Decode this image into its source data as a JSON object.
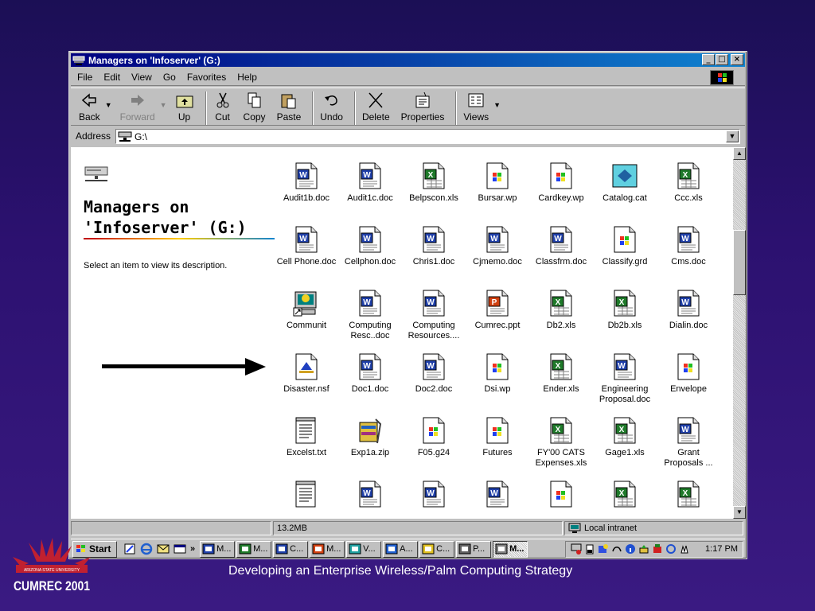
{
  "window": {
    "title": "Managers on 'Infoserver' (G:)",
    "buttons": {
      "minimize": "_",
      "maximize": "□",
      "close": "×"
    }
  },
  "menu": [
    "File",
    "Edit",
    "View",
    "Go",
    "Favorites",
    "Help"
  ],
  "toolbar": [
    {
      "label": "Back",
      "icon": "back-arrow-icon",
      "enabled": true
    },
    {
      "label": "Forward",
      "icon": "forward-arrow-icon",
      "enabled": false
    },
    {
      "label": "Up",
      "icon": "folder-up-icon",
      "enabled": true
    },
    {
      "label": "Cut",
      "icon": "scissors-icon",
      "enabled": true
    },
    {
      "label": "Copy",
      "icon": "copy-icon",
      "enabled": true
    },
    {
      "label": "Paste",
      "icon": "paste-icon",
      "enabled": true
    },
    {
      "label": "Undo",
      "icon": "undo-icon",
      "enabled": true
    },
    {
      "label": "Delete",
      "icon": "delete-x-icon",
      "enabled": true
    },
    {
      "label": "Properties",
      "icon": "properties-icon",
      "enabled": true
    },
    {
      "label": "Views",
      "icon": "views-icon",
      "enabled": true
    }
  ],
  "address": {
    "label": "Address",
    "value": "G:\\"
  },
  "leftpane": {
    "title": "Managers on 'Infoserver' (G:)",
    "description": "Select an item to view its description."
  },
  "files": [
    {
      "name": "Audit1b.doc",
      "type": "word"
    },
    {
      "name": "Audit1c.doc",
      "type": "word"
    },
    {
      "name": "Belpscon.xls",
      "type": "excel"
    },
    {
      "name": "Bursar.wp",
      "type": "generic"
    },
    {
      "name": "Cardkey.wp",
      "type": "generic"
    },
    {
      "name": "Catalog.cat",
      "type": "catalog"
    },
    {
      "name": "Ccc.xls",
      "type": "excel"
    },
    {
      "name": "Cell Phone.doc",
      "type": "word"
    },
    {
      "name": "Cellphon.doc",
      "type": "word"
    },
    {
      "name": "Chris1.doc",
      "type": "word"
    },
    {
      "name": "Cjmemo.doc",
      "type": "word"
    },
    {
      "name": "Classfrm.doc",
      "type": "word"
    },
    {
      "name": "Classify.grd",
      "type": "generic"
    },
    {
      "name": "Cms.doc",
      "type": "word"
    },
    {
      "name": "Communit",
      "type": "shortcut"
    },
    {
      "name": "Computing Resc..doc",
      "type": "word"
    },
    {
      "name": "Computing Resources....",
      "type": "word"
    },
    {
      "name": "Cumrec.ppt",
      "type": "powerpoint"
    },
    {
      "name": "Db2.xls",
      "type": "excel"
    },
    {
      "name": "Db2b.xls",
      "type": "excel"
    },
    {
      "name": "Dialin.doc",
      "type": "word"
    },
    {
      "name": "Disaster.nsf",
      "type": "notes"
    },
    {
      "name": "Doc1.doc",
      "type": "word"
    },
    {
      "name": "Doc2.doc",
      "type": "word"
    },
    {
      "name": "Dsi.wp",
      "type": "generic"
    },
    {
      "name": "Ender.xls",
      "type": "excel"
    },
    {
      "name": "Engineering Proposal.doc",
      "type": "word"
    },
    {
      "name": "Envelope",
      "type": "generic"
    },
    {
      "name": "Excelst.txt",
      "type": "text"
    },
    {
      "name": "Exp1a.zip",
      "type": "zip"
    },
    {
      "name": "F05.g24",
      "type": "generic"
    },
    {
      "name": "Futures",
      "type": "generic"
    },
    {
      "name": "FY'00 CATS Expenses.xls",
      "type": "excel"
    },
    {
      "name": "Gage1.xls",
      "type": "excel"
    },
    {
      "name": "Grant Proposals ...",
      "type": "word"
    },
    {
      "name": "",
      "type": "text"
    },
    {
      "name": "",
      "type": "word"
    },
    {
      "name": "",
      "type": "word"
    },
    {
      "name": "",
      "type": "word"
    },
    {
      "name": "",
      "type": "generic"
    },
    {
      "name": "",
      "type": "excel"
    },
    {
      "name": "",
      "type": "excel"
    }
  ],
  "status": {
    "size": "13.2MB",
    "zone": "Local intranet"
  },
  "taskbar": {
    "start": "Start",
    "chevron": "»",
    "tasks": [
      {
        "label": "M...",
        "icon": "word"
      },
      {
        "label": "M...",
        "icon": "excel"
      },
      {
        "label": "C...",
        "icon": "word"
      },
      {
        "label": "M...",
        "icon": "powerpoint"
      },
      {
        "label": "V...",
        "icon": "visio"
      },
      {
        "label": "A...",
        "icon": "browser"
      },
      {
        "label": "C...",
        "icon": "calendar"
      },
      {
        "label": "P...",
        "icon": "palm"
      },
      {
        "label": "M...",
        "icon": "explorer",
        "active": true
      }
    ],
    "clock": "1:17 PM"
  },
  "slide": {
    "caption": "Developing an Enterprise Wireless/Palm Computing Strategy",
    "logo_text": "CUMREC 2001",
    "logo_subtext": "ARIZONA STATE UNIVERSITY"
  },
  "colors": {
    "titlebar": "#000080",
    "background": "#2c1170",
    "word": "#1f3fa8",
    "excel": "#1f7a2a",
    "powerpoint": "#d04010"
  }
}
